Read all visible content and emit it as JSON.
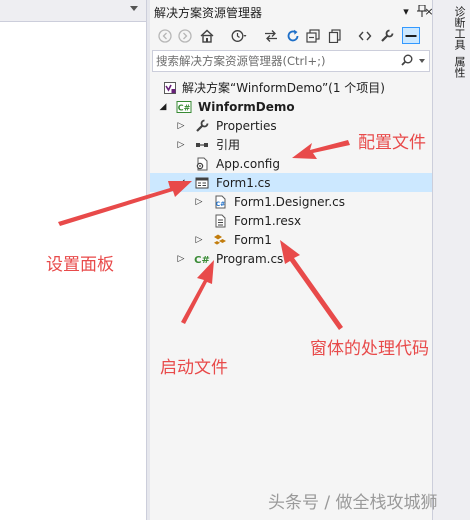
{
  "explorer": {
    "title": "解决方案资源管理器",
    "title_buttons": {
      "dropdown": "▾",
      "pin": "ᛘ",
      "close": "×"
    },
    "search_placeholder": "搜索解决方案资源管理器(Ctrl+;)",
    "tree": {
      "solution": "解决方案“WinformDemo”(1 个项目)",
      "project": "WinformDemo",
      "properties": "Properties",
      "references": "引用",
      "app_config": "App.config",
      "form1_cs": "Form1.cs",
      "form1_designer": "Form1.Designer.cs",
      "form1_resx": "Form1.resx",
      "form1_class": "Form1",
      "program_cs": "Program.cs"
    }
  },
  "right_strip": {
    "tab1": "诊断工具",
    "tab2": "属性"
  },
  "annotations": {
    "config_file": "配置文件",
    "design_panel": "设置面板",
    "startup_file": "启动文件",
    "form_code": "窗体的处理代码"
  },
  "watermark": "头条号 / 做全栈攻城狮",
  "colors": {
    "accent": "#e84a4a",
    "selection": "#cce8ff",
    "background": "#f5f5f5"
  },
  "icons": {
    "toolbar": [
      "back-icon",
      "forward-icon",
      "home-icon",
      "history-icon",
      "sync-icon",
      "refresh-icon",
      "collapse-all-icon",
      "show-all-files-icon",
      "view-code-icon",
      "properties-wrench-icon",
      "preview-icon"
    ]
  }
}
